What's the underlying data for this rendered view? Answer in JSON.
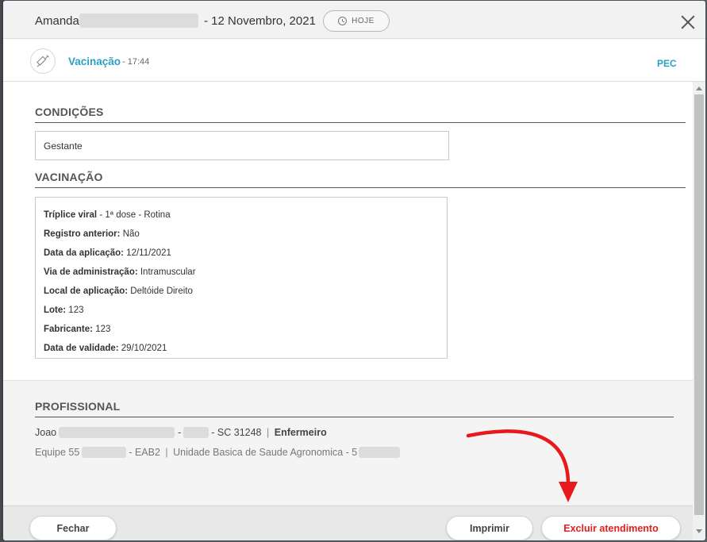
{
  "header": {
    "patient_first_name": "Amanda",
    "date_text": "- 12 Novembro, 2021",
    "hoje_label": "HOJE"
  },
  "record": {
    "title": "Vacinação",
    "time": "- 17:44",
    "source_badge": "PEC"
  },
  "condicoes": {
    "title": "CONDIÇÕES",
    "value": "Gestante"
  },
  "vacinacao": {
    "title": "VACINAÇÃO",
    "rows": [
      {
        "label": "Tríplice viral",
        "value": " - 1ª dose - Rotina"
      },
      {
        "label": "Registro anterior:",
        "value": " Não"
      },
      {
        "label": "Data da aplicação:",
        "value": " 12/11/2021"
      },
      {
        "label": "Via de administração:",
        "value": " Intramuscular"
      },
      {
        "label": "Local de aplicação:",
        "value": " Deltóide Direito"
      },
      {
        "label": "Lote:",
        "value": " 123"
      },
      {
        "label": "Fabricante:",
        "value": " 123"
      },
      {
        "label": "Data de validade:",
        "value": " 29/10/2021"
      }
    ]
  },
  "profissional": {
    "title": "PROFISSIONAL",
    "name_prefix": "Joao",
    "dash1": "-",
    "registry": "- SC 31248",
    "separator": "|",
    "role": "Enfermeiro",
    "team_prefix": "Equipe 55",
    "team_suffix": "- EAB2",
    "unit": "Unidade Basica de Saude Agronomica - 5"
  },
  "actions": {
    "close_label": "Fechar",
    "print_label": "Imprimir",
    "delete_label": "Excluir atendimento"
  },
  "colors": {
    "accent": "#2aa0c2",
    "danger": "#e0201e",
    "annotation_arrow": "#e8191c"
  }
}
